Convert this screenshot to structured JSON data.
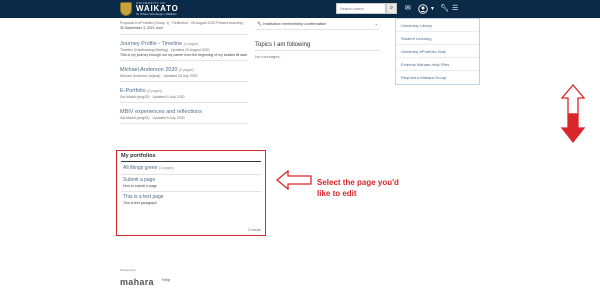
{
  "header": {
    "logo_small": "UNIVERSITY OF",
    "logo_main": "WAIKATO",
    "logo_sub": "Te Whare Wananga o Waikato",
    "search_placeholder": "Search users",
    "search_icon": "search-icon",
    "icons": [
      "envelope-icon",
      "user-icon",
      "chevron-down-icon",
      "wrench-icon",
      "hamburger-menu-icon"
    ]
  },
  "left_list": [
    {
      "title": "",
      "meta": "Proposal in ePortfolio (Group 1) · Reflection · 26 August 2020 Present teaching",
      "desc": "30 September 3, 2021 June"
    },
    {
      "title": "Journey Profile - Timeline",
      "pages": "(4 pages)",
      "meta": "Timeline (Kaialharangi Waring) · Updated 20 August 2020",
      "desc": "This is my journey through out my career from the beginning of my studies till date."
    },
    {
      "title": "Michael Anderson 2020",
      "pages": "(5 pages)",
      "meta": "Michael Anderson (mjaus) · Updated 25 July 2020",
      "desc": ""
    },
    {
      "title": "E-Portfolio",
      "pages": "(6 pages)",
      "meta": "Sai Maddi (smg33) · Updated 9 July 2020",
      "desc": ""
    },
    {
      "title": "MBIV experiences and reflections",
      "pages": "",
      "meta": "Sai Maddi (smg33) · Updated 9 July 2020",
      "desc": ""
    }
  ],
  "middle": {
    "institution_row": "Institution membership confirmation",
    "topics_title": "Topics I am following",
    "no_messages": "No messages."
  },
  "dropdown": [
    "University Library",
    "Student Learning",
    "University ePortfolio Help",
    "External Mahara Help Files",
    "Request a Mahara Group"
  ],
  "portfolios": {
    "heading": "My portfolios",
    "items": [
      {
        "title": "All things green",
        "pages": "(4 pages)",
        "desc": ""
      },
      {
        "title": "Submit a page",
        "pages": "",
        "desc": "How to submit a page"
      },
      {
        "title": "This is a test page",
        "pages": "",
        "desc": "This is test paragraph"
      }
    ],
    "results": "3 results"
  },
  "annotation": {
    "line1": "Select the page you'd",
    "line2": "like to edit",
    "color": "#d9262a"
  },
  "footer": {
    "powered_by": "Powered by",
    "brand": "mahara",
    "help": "Help"
  }
}
